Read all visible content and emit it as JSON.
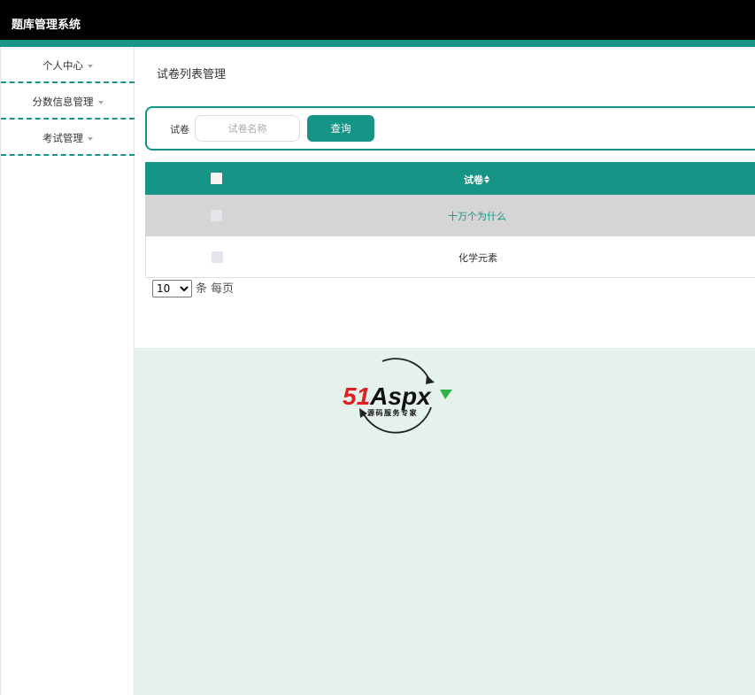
{
  "app": {
    "title": "题库管理系统"
  },
  "sidebar": {
    "items": [
      {
        "label": "个人中心"
      },
      {
        "label": "分数信息管理"
      },
      {
        "label": "考试管理"
      }
    ]
  },
  "main": {
    "page_title": "试卷列表管理",
    "search": {
      "label": "试卷",
      "placeholder": "试卷名称",
      "value": "",
      "button_label": "查询"
    },
    "table": {
      "columns": [
        "试卷"
      ],
      "rows": [
        {
          "name": "十万个为什么"
        },
        {
          "name": "化学元素"
        }
      ]
    },
    "pager": {
      "page_size": "10",
      "options": [
        "10"
      ],
      "suffix": "条 每页"
    }
  },
  "watermark": {
    "brand": "51Aspx",
    "tagline": "源码服务专家"
  },
  "colors": {
    "accent": "#169485",
    "topbar": "#000000",
    "content_bg": "#e5f2ec"
  }
}
